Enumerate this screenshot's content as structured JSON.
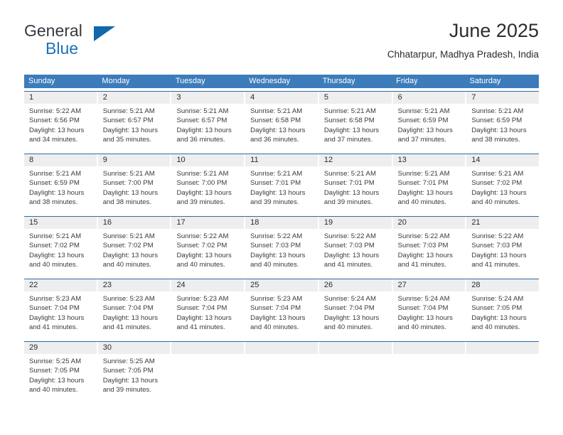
{
  "brand": {
    "name_part1": "General",
    "name_part2": "Blue",
    "triangle_icon": "triangle-icon",
    "color_dark": "#33393f",
    "color_blue": "#1d72b8"
  },
  "header": {
    "title": "June 2025",
    "subtitle": "Chhatarpur, Madhya Pradesh, India"
  },
  "theme": {
    "header_row_bg": "#3c7cba",
    "week_divider": "#2d6ca8",
    "datenum_bg": "#eeeeee",
    "text": "#2c2c2c"
  },
  "calendar": {
    "day_headers": [
      "Sunday",
      "Monday",
      "Tuesday",
      "Wednesday",
      "Thursday",
      "Friday",
      "Saturday"
    ],
    "weeks": [
      {
        "days": [
          {
            "date": "1",
            "sunrise": "Sunrise: 5:22 AM",
            "sunset": "Sunset: 6:56 PM",
            "daylight_line1": "Daylight: 13 hours",
            "daylight_line2": "and 34 minutes."
          },
          {
            "date": "2",
            "sunrise": "Sunrise: 5:21 AM",
            "sunset": "Sunset: 6:57 PM",
            "daylight_line1": "Daylight: 13 hours",
            "daylight_line2": "and 35 minutes."
          },
          {
            "date": "3",
            "sunrise": "Sunrise: 5:21 AM",
            "sunset": "Sunset: 6:57 PM",
            "daylight_line1": "Daylight: 13 hours",
            "daylight_line2": "and 36 minutes."
          },
          {
            "date": "4",
            "sunrise": "Sunrise: 5:21 AM",
            "sunset": "Sunset: 6:58 PM",
            "daylight_line1": "Daylight: 13 hours",
            "daylight_line2": "and 36 minutes."
          },
          {
            "date": "5",
            "sunrise": "Sunrise: 5:21 AM",
            "sunset": "Sunset: 6:58 PM",
            "daylight_line1": "Daylight: 13 hours",
            "daylight_line2": "and 37 minutes."
          },
          {
            "date": "6",
            "sunrise": "Sunrise: 5:21 AM",
            "sunset": "Sunset: 6:59 PM",
            "daylight_line1": "Daylight: 13 hours",
            "daylight_line2": "and 37 minutes."
          },
          {
            "date": "7",
            "sunrise": "Sunrise: 5:21 AM",
            "sunset": "Sunset: 6:59 PM",
            "daylight_line1": "Daylight: 13 hours",
            "daylight_line2": "and 38 minutes."
          }
        ]
      },
      {
        "days": [
          {
            "date": "8",
            "sunrise": "Sunrise: 5:21 AM",
            "sunset": "Sunset: 6:59 PM",
            "daylight_line1": "Daylight: 13 hours",
            "daylight_line2": "and 38 minutes."
          },
          {
            "date": "9",
            "sunrise": "Sunrise: 5:21 AM",
            "sunset": "Sunset: 7:00 PM",
            "daylight_line1": "Daylight: 13 hours",
            "daylight_line2": "and 38 minutes."
          },
          {
            "date": "10",
            "sunrise": "Sunrise: 5:21 AM",
            "sunset": "Sunset: 7:00 PM",
            "daylight_line1": "Daylight: 13 hours",
            "daylight_line2": "and 39 minutes."
          },
          {
            "date": "11",
            "sunrise": "Sunrise: 5:21 AM",
            "sunset": "Sunset: 7:01 PM",
            "daylight_line1": "Daylight: 13 hours",
            "daylight_line2": "and 39 minutes."
          },
          {
            "date": "12",
            "sunrise": "Sunrise: 5:21 AM",
            "sunset": "Sunset: 7:01 PM",
            "daylight_line1": "Daylight: 13 hours",
            "daylight_line2": "and 39 minutes."
          },
          {
            "date": "13",
            "sunrise": "Sunrise: 5:21 AM",
            "sunset": "Sunset: 7:01 PM",
            "daylight_line1": "Daylight: 13 hours",
            "daylight_line2": "and 40 minutes."
          },
          {
            "date": "14",
            "sunrise": "Sunrise: 5:21 AM",
            "sunset": "Sunset: 7:02 PM",
            "daylight_line1": "Daylight: 13 hours",
            "daylight_line2": "and 40 minutes."
          }
        ]
      },
      {
        "days": [
          {
            "date": "15",
            "sunrise": "Sunrise: 5:21 AM",
            "sunset": "Sunset: 7:02 PM",
            "daylight_line1": "Daylight: 13 hours",
            "daylight_line2": "and 40 minutes."
          },
          {
            "date": "16",
            "sunrise": "Sunrise: 5:21 AM",
            "sunset": "Sunset: 7:02 PM",
            "daylight_line1": "Daylight: 13 hours",
            "daylight_line2": "and 40 minutes."
          },
          {
            "date": "17",
            "sunrise": "Sunrise: 5:22 AM",
            "sunset": "Sunset: 7:02 PM",
            "daylight_line1": "Daylight: 13 hours",
            "daylight_line2": "and 40 minutes."
          },
          {
            "date": "18",
            "sunrise": "Sunrise: 5:22 AM",
            "sunset": "Sunset: 7:03 PM",
            "daylight_line1": "Daylight: 13 hours",
            "daylight_line2": "and 40 minutes."
          },
          {
            "date": "19",
            "sunrise": "Sunrise: 5:22 AM",
            "sunset": "Sunset: 7:03 PM",
            "daylight_line1": "Daylight: 13 hours",
            "daylight_line2": "and 41 minutes."
          },
          {
            "date": "20",
            "sunrise": "Sunrise: 5:22 AM",
            "sunset": "Sunset: 7:03 PM",
            "daylight_line1": "Daylight: 13 hours",
            "daylight_line2": "and 41 minutes."
          },
          {
            "date": "21",
            "sunrise": "Sunrise: 5:22 AM",
            "sunset": "Sunset: 7:03 PM",
            "daylight_line1": "Daylight: 13 hours",
            "daylight_line2": "and 41 minutes."
          }
        ]
      },
      {
        "days": [
          {
            "date": "22",
            "sunrise": "Sunrise: 5:23 AM",
            "sunset": "Sunset: 7:04 PM",
            "daylight_line1": "Daylight: 13 hours",
            "daylight_line2": "and 41 minutes."
          },
          {
            "date": "23",
            "sunrise": "Sunrise: 5:23 AM",
            "sunset": "Sunset: 7:04 PM",
            "daylight_line1": "Daylight: 13 hours",
            "daylight_line2": "and 41 minutes."
          },
          {
            "date": "24",
            "sunrise": "Sunrise: 5:23 AM",
            "sunset": "Sunset: 7:04 PM",
            "daylight_line1": "Daylight: 13 hours",
            "daylight_line2": "and 41 minutes."
          },
          {
            "date": "25",
            "sunrise": "Sunrise: 5:23 AM",
            "sunset": "Sunset: 7:04 PM",
            "daylight_line1": "Daylight: 13 hours",
            "daylight_line2": "and 40 minutes."
          },
          {
            "date": "26",
            "sunrise": "Sunrise: 5:24 AM",
            "sunset": "Sunset: 7:04 PM",
            "daylight_line1": "Daylight: 13 hours",
            "daylight_line2": "and 40 minutes."
          },
          {
            "date": "27",
            "sunrise": "Sunrise: 5:24 AM",
            "sunset": "Sunset: 7:04 PM",
            "daylight_line1": "Daylight: 13 hours",
            "daylight_line2": "and 40 minutes."
          },
          {
            "date": "28",
            "sunrise": "Sunrise: 5:24 AM",
            "sunset": "Sunset: 7:05 PM",
            "daylight_line1": "Daylight: 13 hours",
            "daylight_line2": "and 40 minutes."
          }
        ]
      },
      {
        "days": [
          {
            "date": "29",
            "sunrise": "Sunrise: 5:25 AM",
            "sunset": "Sunset: 7:05 PM",
            "daylight_line1": "Daylight: 13 hours",
            "daylight_line2": "and 40 minutes."
          },
          {
            "date": "30",
            "sunrise": "Sunrise: 5:25 AM",
            "sunset": "Sunset: 7:05 PM",
            "daylight_line1": "Daylight: 13 hours",
            "daylight_line2": "and 39 minutes."
          },
          {
            "date": "",
            "sunrise": "",
            "sunset": "",
            "daylight_line1": "",
            "daylight_line2": ""
          },
          {
            "date": "",
            "sunrise": "",
            "sunset": "",
            "daylight_line1": "",
            "daylight_line2": ""
          },
          {
            "date": "",
            "sunrise": "",
            "sunset": "",
            "daylight_line1": "",
            "daylight_line2": ""
          },
          {
            "date": "",
            "sunrise": "",
            "sunset": "",
            "daylight_line1": "",
            "daylight_line2": ""
          },
          {
            "date": "",
            "sunrise": "",
            "sunset": "",
            "daylight_line1": "",
            "daylight_line2": ""
          }
        ]
      }
    ]
  }
}
